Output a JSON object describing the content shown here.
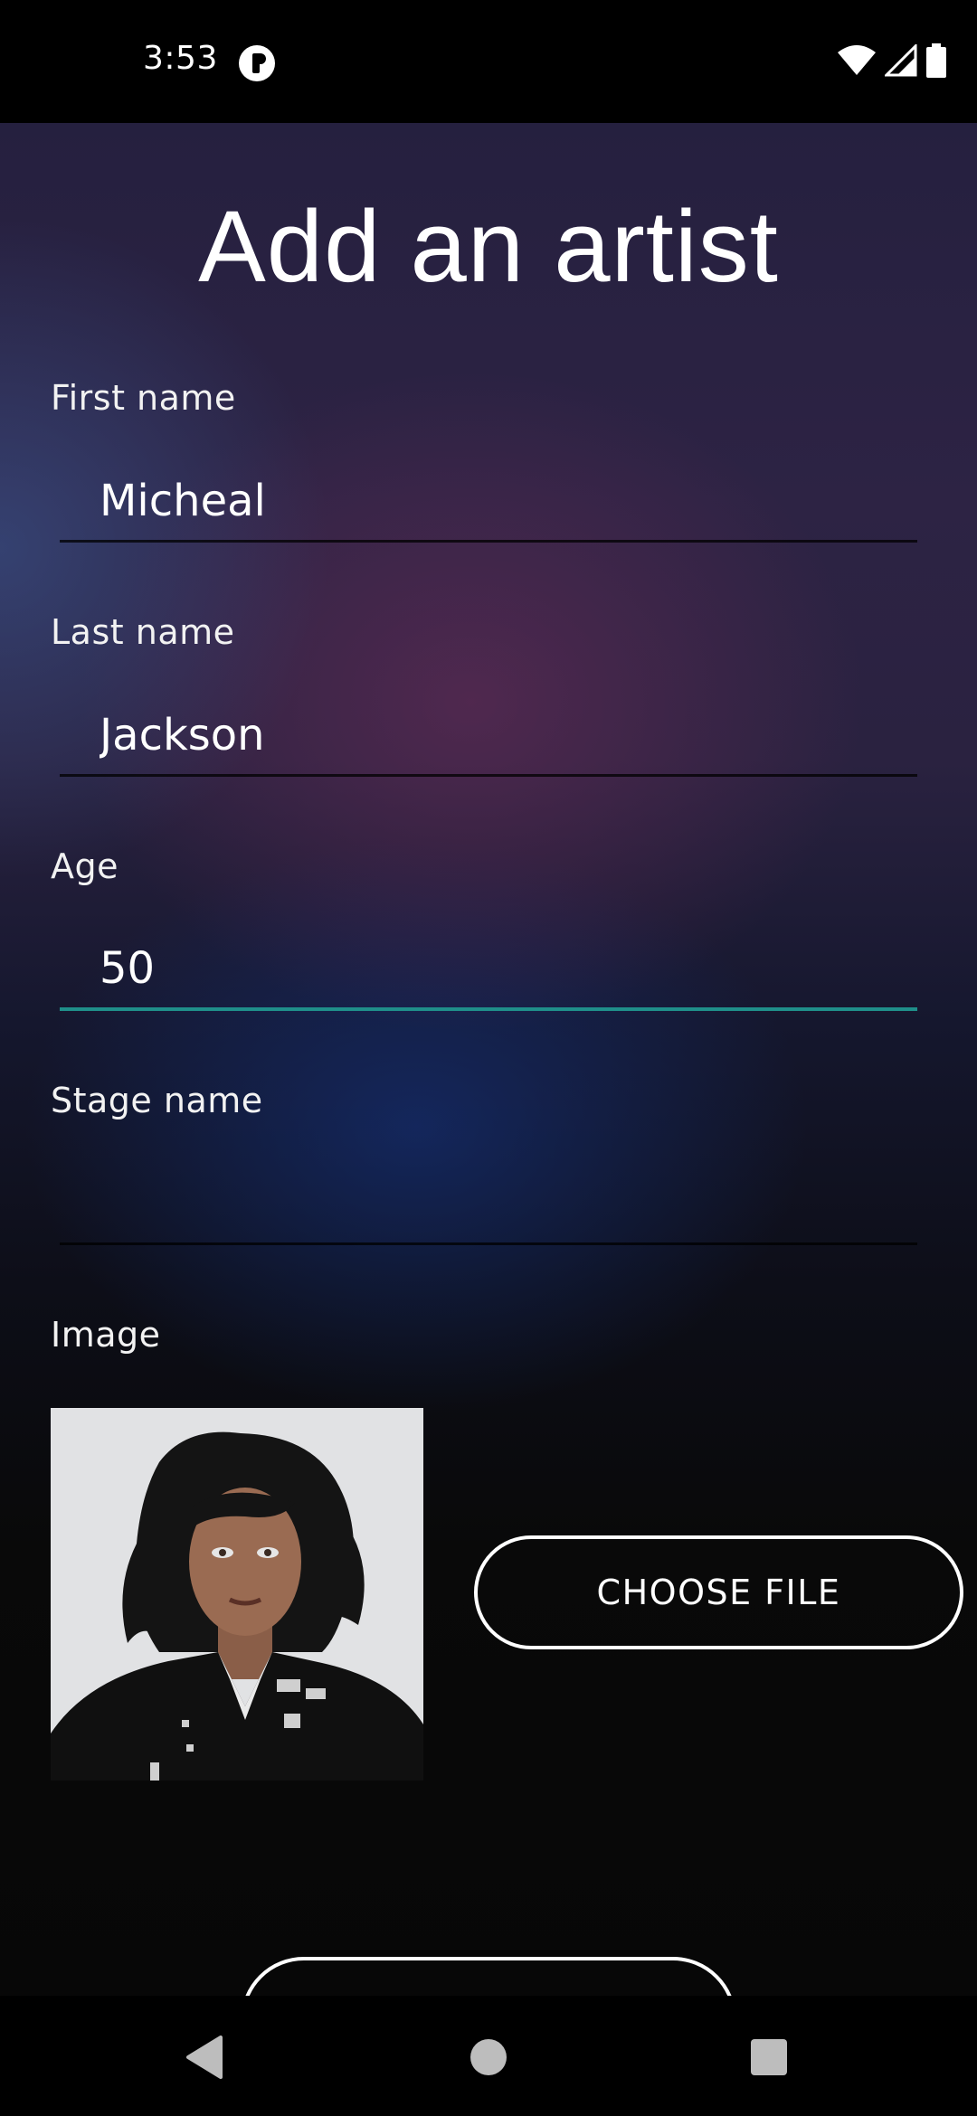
{
  "status_bar": {
    "time": "3:53",
    "icons": [
      "app-notification-icon",
      "wifi-icon",
      "cellular-signal-icon",
      "battery-icon"
    ]
  },
  "page": {
    "title": "Add an artist"
  },
  "form": {
    "first_name": {
      "label": "First name",
      "value": "Micheal"
    },
    "last_name": {
      "label": "Last name",
      "value": "Jackson"
    },
    "age": {
      "label": "Age",
      "value": "50"
    },
    "stage_name": {
      "label": "Stage name",
      "value": ""
    },
    "image": {
      "label": "Image",
      "choose_file_label": "CHOOSE FILE"
    }
  },
  "nav_bar": {
    "icons": [
      "back-icon",
      "home-icon",
      "recents-icon"
    ]
  },
  "colors": {
    "focus_underline": "#1f8f8a",
    "background_top": "#25203f",
    "background_bottom": "#070707"
  }
}
